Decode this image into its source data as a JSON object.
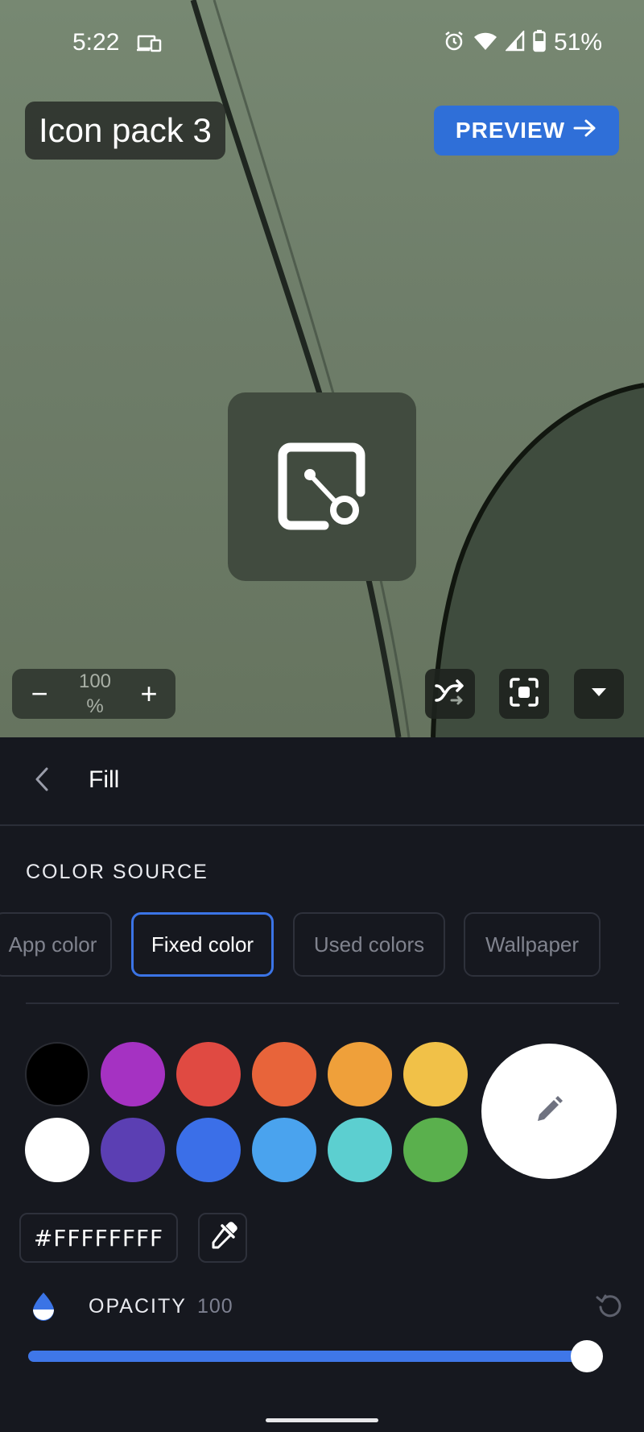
{
  "status_bar": {
    "time": "5:22",
    "battery": "51%",
    "icons": [
      "cast-icon",
      "alarm-icon",
      "wifi-icon",
      "signal-icon",
      "battery-icon"
    ]
  },
  "preview": {
    "title": "Icon pack 3",
    "preview_button": "PREVIEW",
    "zoom_value": "100 %",
    "zoom_minus": "−",
    "zoom_plus": "+",
    "tools": [
      "shuffle-icon",
      "fit-screen-icon",
      "dropdown-icon"
    ]
  },
  "panel": {
    "title": "Fill",
    "color_source_label": "COLOR SOURCE",
    "chips": [
      {
        "label": "App color",
        "active": false
      },
      {
        "label": "Fixed color",
        "active": true
      },
      {
        "label": "Used colors",
        "active": false
      },
      {
        "label": "Wallpaper",
        "active": false
      }
    ],
    "swatches": [
      "#000000",
      "#a532c2",
      "#e04a42",
      "#e8643a",
      "#efa03a",
      "#f1c148",
      "#ffffff",
      "#5b3fb3",
      "#3b6fe8",
      "#4aa3ee",
      "#5ccfd0",
      "#5ab04d"
    ],
    "selected_color": "#ffffff",
    "hex_value": "#FFFFFFFF",
    "opacity_label": "OPACITY",
    "opacity_value": "100",
    "opacity_fraction": 1.0
  },
  "colors": {
    "accent": "#3b74e6",
    "preview_button": "#2f6fd8",
    "panel_bg": "#16181f"
  }
}
